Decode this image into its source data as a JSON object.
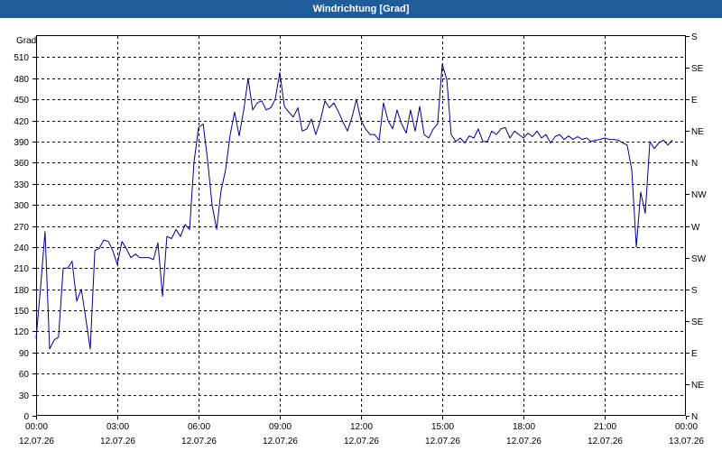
{
  "window": {
    "title": "Windrichtung [Grad]"
  },
  "chart_data": {
    "type": "line",
    "title": "Windrichtung [Grad]",
    "ylabel": "Grad",
    "xlabel": "",
    "ylim": [
      0,
      540
    ],
    "xlim_hours": [
      0,
      24
    ],
    "y_ticks": [
      0,
      30,
      60,
      90,
      120,
      150,
      180,
      210,
      240,
      270,
      300,
      330,
      360,
      390,
      420,
      450,
      480,
      510
    ],
    "y2_ticks": [
      {
        "value": 0,
        "label": "N"
      },
      {
        "value": 45,
        "label": "NE"
      },
      {
        "value": 90,
        "label": "E"
      },
      {
        "value": 135,
        "label": "SE"
      },
      {
        "value": 180,
        "label": "S"
      },
      {
        "value": 225,
        "label": "SW"
      },
      {
        "value": 270,
        "label": "W"
      },
      {
        "value": 315,
        "label": "NW"
      },
      {
        "value": 360,
        "label": "N"
      },
      {
        "value": 405,
        "label": "NE"
      },
      {
        "value": 450,
        "label": "E"
      },
      {
        "value": 495,
        "label": "SE"
      },
      {
        "value": 540,
        "label": "S"
      }
    ],
    "x_ticks": [
      {
        "hour": 0,
        "time": "00:00",
        "date": "12.07.26"
      },
      {
        "hour": 3,
        "time": "03:00",
        "date": "12.07.26"
      },
      {
        "hour": 6,
        "time": "06:00",
        "date": "12.07.26"
      },
      {
        "hour": 9,
        "time": "09:00",
        "date": "12.07.26"
      },
      {
        "hour": 12,
        "time": "12:00",
        "date": "12.07.26"
      },
      {
        "hour": 15,
        "time": "15:00",
        "date": "12.07.26"
      },
      {
        "hour": 18,
        "time": "18:00",
        "date": "12.07.26"
      },
      {
        "hour": 21,
        "time": "21:00",
        "date": "12.07.26"
      },
      {
        "hour": 24,
        "time": "00:00",
        "date": "13.07.26"
      }
    ],
    "grid": true,
    "series": [
      {
        "color": "#00008b",
        "points": [
          [
            0.0,
            110
          ],
          [
            0.17,
            185
          ],
          [
            0.33,
            262
          ],
          [
            0.5,
            95
          ],
          [
            0.67,
            108
          ],
          [
            0.83,
            112
          ],
          [
            1.0,
            210
          ],
          [
            1.17,
            210
          ],
          [
            1.33,
            220
          ],
          [
            1.5,
            163
          ],
          [
            1.67,
            180
          ],
          [
            1.83,
            140
          ],
          [
            2.0,
            95
          ],
          [
            2.17,
            235
          ],
          [
            2.33,
            238
          ],
          [
            2.5,
            250
          ],
          [
            2.67,
            248
          ],
          [
            2.83,
            235
          ],
          [
            3.0,
            215
          ],
          [
            3.17,
            248
          ],
          [
            3.33,
            238
          ],
          [
            3.5,
            225
          ],
          [
            3.67,
            230
          ],
          [
            3.83,
            225
          ],
          [
            4.0,
            225
          ],
          [
            4.17,
            225
          ],
          [
            4.33,
            222
          ],
          [
            4.5,
            246
          ],
          [
            4.67,
            170
          ],
          [
            4.83,
            255
          ],
          [
            5.0,
            252
          ],
          [
            5.17,
            265
          ],
          [
            5.33,
            255
          ],
          [
            5.5,
            272
          ],
          [
            5.67,
            265
          ],
          [
            5.83,
            360
          ],
          [
            6.0,
            410
          ],
          [
            6.17,
            415
          ],
          [
            6.33,
            365
          ],
          [
            6.5,
            300
          ],
          [
            6.67,
            265
          ],
          [
            6.83,
            320
          ],
          [
            7.0,
            350
          ],
          [
            7.17,
            400
          ],
          [
            7.33,
            432
          ],
          [
            7.5,
            398
          ],
          [
            7.67,
            435
          ],
          [
            7.83,
            480
          ],
          [
            8.0,
            435
          ],
          [
            8.17,
            445
          ],
          [
            8.33,
            448
          ],
          [
            8.5,
            435
          ],
          [
            8.67,
            438
          ],
          [
            8.83,
            450
          ],
          [
            9.0,
            488
          ],
          [
            9.17,
            440
          ],
          [
            9.33,
            432
          ],
          [
            9.5,
            425
          ],
          [
            9.67,
            438
          ],
          [
            9.83,
            405
          ],
          [
            10.0,
            408
          ],
          [
            10.17,
            422
          ],
          [
            10.33,
            400
          ],
          [
            10.5,
            420
          ],
          [
            10.67,
            448
          ],
          [
            10.83,
            438
          ],
          [
            11.0,
            445
          ],
          [
            11.17,
            432
          ],
          [
            11.33,
            418
          ],
          [
            11.5,
            405
          ],
          [
            11.67,
            425
          ],
          [
            11.83,
            450
          ],
          [
            12.0,
            420
          ],
          [
            12.17,
            408
          ],
          [
            12.33,
            400
          ],
          [
            12.5,
            400
          ],
          [
            12.67,
            392
          ],
          [
            12.83,
            445
          ],
          [
            13.0,
            420
          ],
          [
            13.17,
            408
          ],
          [
            13.33,
            435
          ],
          [
            13.5,
            415
          ],
          [
            13.67,
            402
          ],
          [
            13.83,
            435
          ],
          [
            14.0,
            405
          ],
          [
            14.17,
            440
          ],
          [
            14.33,
            400
          ],
          [
            14.5,
            395
          ],
          [
            14.67,
            408
          ],
          [
            14.83,
            415
          ],
          [
            15.0,
            500
          ],
          [
            15.17,
            478
          ],
          [
            15.33,
            400
          ],
          [
            15.5,
            390
          ],
          [
            15.67,
            395
          ],
          [
            15.83,
            388
          ],
          [
            16.0,
            398
          ],
          [
            16.17,
            395
          ],
          [
            16.33,
            408
          ],
          [
            16.5,
            390
          ],
          [
            16.67,
            390
          ],
          [
            16.83,
            405
          ],
          [
            17.0,
            400
          ],
          [
            17.17,
            408
          ],
          [
            17.33,
            410
          ],
          [
            17.5,
            395
          ],
          [
            17.67,
            405
          ],
          [
            17.83,
            400
          ],
          [
            18.0,
            395
          ],
          [
            18.17,
            402
          ],
          [
            18.33,
            397
          ],
          [
            18.5,
            405
          ],
          [
            18.67,
            395
          ],
          [
            18.83,
            400
          ],
          [
            19.0,
            388
          ],
          [
            19.17,
            397
          ],
          [
            19.33,
            400
          ],
          [
            19.5,
            393
          ],
          [
            19.67,
            398
          ],
          [
            19.83,
            393
          ],
          [
            20.0,
            397
          ],
          [
            20.17,
            393
          ],
          [
            20.33,
            395
          ],
          [
            20.5,
            390
          ],
          [
            20.67,
            392
          ],
          [
            20.83,
            393
          ],
          [
            21.0,
            395
          ],
          [
            21.17,
            393
          ],
          [
            21.33,
            393
          ],
          [
            21.5,
            392
          ],
          [
            21.67,
            388
          ],
          [
            21.83,
            385
          ],
          [
            22.0,
            350
          ],
          [
            22.17,
            240
          ],
          [
            22.33,
            318
          ],
          [
            22.5,
            288
          ],
          [
            22.67,
            390
          ],
          [
            22.83,
            380
          ],
          [
            23.0,
            388
          ],
          [
            23.17,
            392
          ],
          [
            23.33,
            385
          ],
          [
            23.5,
            392
          ]
        ]
      }
    ]
  }
}
